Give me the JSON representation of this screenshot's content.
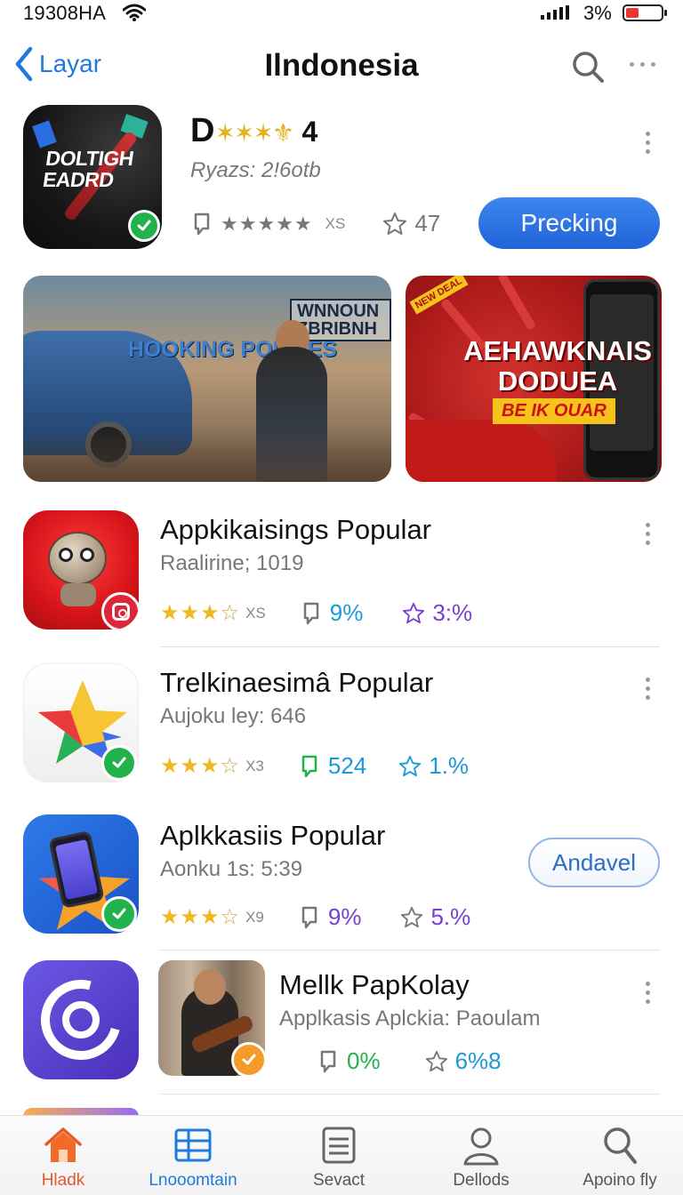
{
  "status_bar": {
    "time": "19308HA",
    "battery_pct": "3%"
  },
  "nav": {
    "back_label": "Layar",
    "title": "Ilndonesia"
  },
  "featured": {
    "name": "D",
    "name_suffix": "4",
    "subtitle": "Ryazs: 2!6otb",
    "rating_label": "XS",
    "likes": "47",
    "button_label": "Precking",
    "icon_text": "DOLTIGH EADRD"
  },
  "banners": [
    {
      "title": "HOOKING POMRES",
      "sign": "WNNOUN ZBRIBNH"
    },
    {
      "tag": "NEW DEAL",
      "title": "AEHAWKNAIS DODUEA",
      "strip": "BE IK OUAR"
    }
  ],
  "list": [
    {
      "name": "Appkikaisings Popular",
      "sub": "Raalirine; 1019",
      "rating_label": "XS",
      "metric1": "9%",
      "metric2": "3:%"
    },
    {
      "name": "Trelkinaesimâ Popular",
      "sub": "Aujoku ley: 646",
      "rating_label": "X3",
      "metric1": "524",
      "metric2": "1.%"
    },
    {
      "name": "Aplkkasiis Popular",
      "sub": "Aonku 1s: 5:39",
      "rating_label": "X9",
      "metric1": "9%",
      "metric2": "5.%",
      "button_label": "Andavel"
    },
    {
      "name": "Mellk PapKolay",
      "sub": "Applkasis Aplckia: Paoulam",
      "metric1": "0%",
      "metric2": "6%8"
    }
  ],
  "tabs": [
    {
      "label": "Hladk"
    },
    {
      "label": "Lnooomtain"
    },
    {
      "label": "Sevact"
    },
    {
      "label": "Dellods"
    },
    {
      "label": "Apoino fly"
    }
  ],
  "colors": {
    "accent_blue": "#1f7ae0",
    "primary_button": "#2a70e2",
    "star_yellow": "#f2b823",
    "check_green": "#22b24c",
    "metric_blue": "#1a9bd8",
    "metric_green": "#22b24c",
    "metric_purple": "#7a3fd0",
    "home_orange": "#e8572a"
  },
  "icons": {
    "back": "chevron-left-icon",
    "search": "search-icon",
    "more": "more-horizontal-icon",
    "verified": "check-circle-icon",
    "comment": "comment-icon",
    "favorite": "star-outline-icon",
    "home": "home-icon",
    "browse": "grid-icon",
    "search_tab": "document-icon",
    "account": "person-icon"
  }
}
